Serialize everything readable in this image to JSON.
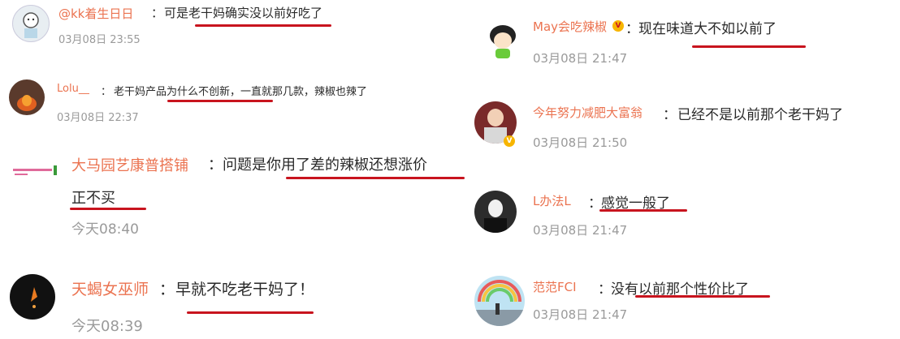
{
  "comments": [
    {
      "username": "@kk着生日日",
      "sep": "：",
      "text": "可是老干妈确实没以前好吃了",
      "timestamp": "03月08日 23:55",
      "avatar": "cartoon-avatar-icon"
    },
    {
      "username": "Lolu__",
      "sep": "：",
      "text": "老干妈产品为什么不创新，一直就那几款，辣椒也辣了",
      "timestamp": "03月08日 22:37",
      "avatar": "fire-avatar-icon"
    },
    {
      "username": "大马园艺康普搭铺",
      "sep": "：",
      "text": "问题是你用了差的辣椒还想涨价",
      "text2": "正不买",
      "timestamp": "今天08:40",
      "avatar": "text-logo-avatar"
    },
    {
      "username": "天蝎女巫师",
      "sep": "：",
      "text": "早就不吃老干妈了！",
      "timestamp": "今天08:39",
      "avatar": "dark-avatar-icon"
    },
    {
      "username": "May会吃辣椒",
      "sep": "：",
      "text": "现在味道大不如以前了",
      "timestamp": "03月08日 21:47",
      "avatar": "cartoon-girl-avatar",
      "badge": "V"
    },
    {
      "username": "今年努力减肥大富翁",
      "sep": "：",
      "text": "已经不是以前那个老干妈了",
      "timestamp": "03月08日 21:50",
      "avatar": "red-avatar",
      "badge": "V"
    },
    {
      "username": "L办法L",
      "sep": "：",
      "text": "感觉一般了",
      "timestamp": "03月08日 21:47",
      "avatar": "person-avatar"
    },
    {
      "username": "范范FCI",
      "sep": "：",
      "text": "没有以前那个性价比了",
      "timestamp": "03月08日 21:47",
      "avatar": "rainbow-avatar"
    }
  ],
  "colors": {
    "username": "#eb7350",
    "underline": "#c8141e",
    "timestamp": "#9a9a9a",
    "text": "#2a2a2a"
  }
}
